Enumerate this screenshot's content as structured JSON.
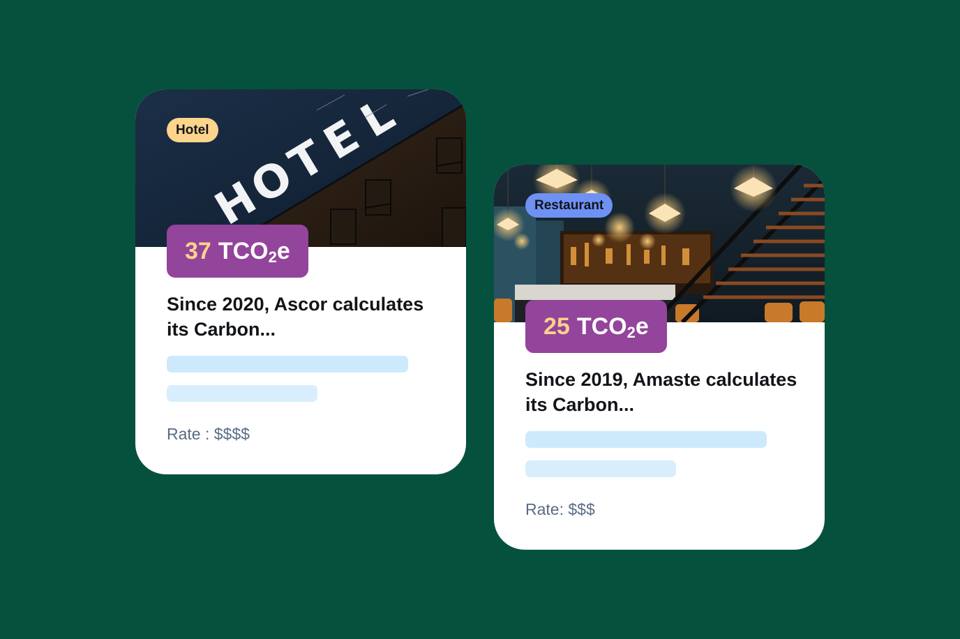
{
  "theme": {
    "background": "#05513d",
    "co2_badge_bg": "#93449b",
    "co2_value_color": "#fdd28a",
    "co2_unit_color": "#ffffff",
    "placeholder_color_1": "#cdeafc",
    "placeholder_color_2": "#d8eefc"
  },
  "cards": [
    {
      "image": "hotel-building-sign-photo",
      "photo_sign_letters": [
        "H",
        "O",
        "T",
        "E",
        "L"
      ],
      "category": "Hotel",
      "category_color": "#fdd48c",
      "co2_value": "37",
      "co2_unit_prefix": "TCO",
      "co2_unit_subscript": "2",
      "co2_unit_suffix": "e",
      "headline": "Since 2020, Ascor calculates its Carbon...",
      "rate": "Rate : $$$$"
    },
    {
      "image": "restaurant-interior-photo",
      "category": "Restaurant",
      "category_color": "#6f91f4",
      "co2_value": "25",
      "co2_unit_prefix": "TCO",
      "co2_unit_subscript": "2",
      "co2_unit_suffix": "e",
      "headline": "Since 2019, Amaste calculates its Carbon...",
      "rate": "Rate: $$$"
    }
  ]
}
